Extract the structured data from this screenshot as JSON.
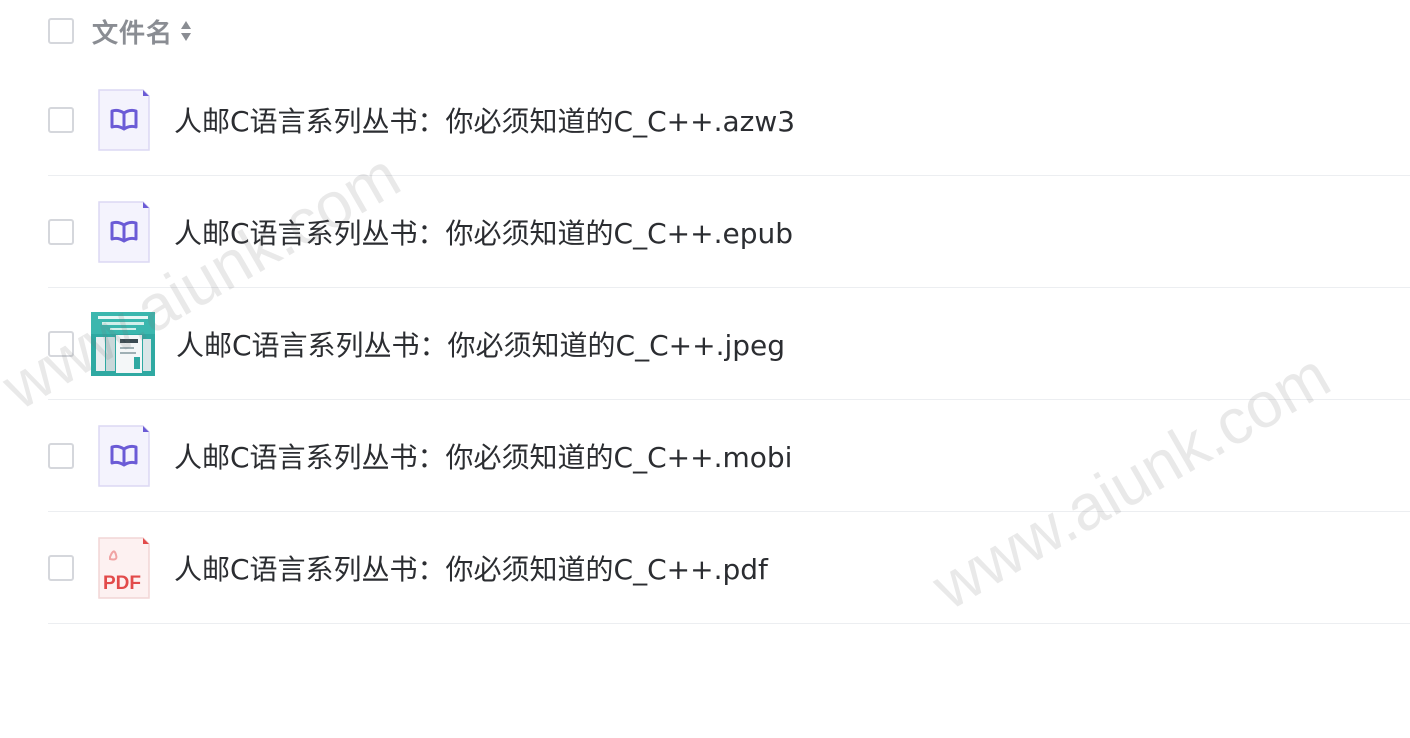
{
  "header": {
    "title": "文件名"
  },
  "files": [
    {
      "name": "人邮C语言系列丛书：你必须知道的C_C++.azw3",
      "icon": "ebook-icon"
    },
    {
      "name": "人邮C语言系列丛书：你必须知道的C_C++.epub",
      "icon": "ebook-icon"
    },
    {
      "name": "人邮C语言系列丛书：你必须知道的C_C++.jpeg",
      "icon": "image-thumbnail"
    },
    {
      "name": "人邮C语言系列丛书：你必须知道的C_C++.mobi",
      "icon": "ebook-icon"
    },
    {
      "name": "人邮C语言系列丛书：你必须知道的C_C++.pdf",
      "icon": "pdf-icon"
    }
  ],
  "pdf_label": "PDF",
  "watermark": "www.aiunk.com",
  "colors": {
    "ebook_accent": "#6b5bd6",
    "pdf_accent": "#e24b4b",
    "thumb_teal": "#2fa9a2"
  }
}
